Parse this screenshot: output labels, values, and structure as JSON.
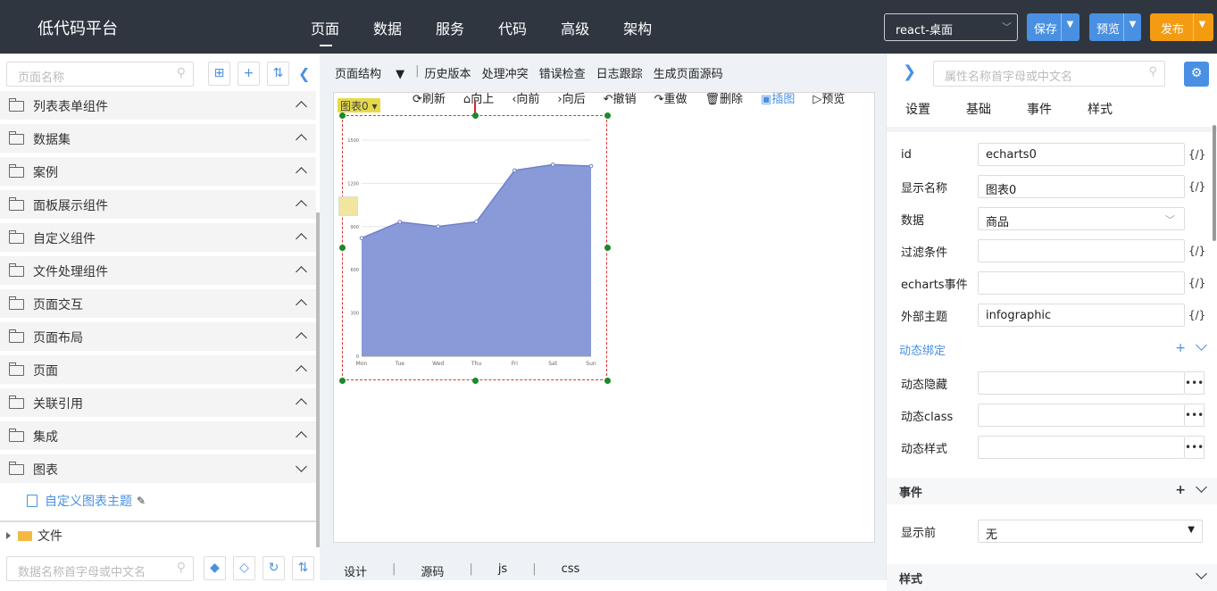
{
  "header": {
    "brand": "低代码平台",
    "nav": [
      "页面",
      "数据",
      "服务",
      "代码",
      "高级",
      "架构"
    ],
    "env_select": "react-桌面",
    "save": "保存",
    "preview": "预览",
    "publish": "发布"
  },
  "left": {
    "search_placeholder": "页面名称",
    "tree": [
      {
        "label": "列表表单组件",
        "expanded": false
      },
      {
        "label": "数据集",
        "expanded": false
      },
      {
        "label": "案例",
        "expanded": false
      },
      {
        "label": "面板展示组件",
        "expanded": false
      },
      {
        "label": "自定义组件",
        "expanded": false
      },
      {
        "label": "文件处理组件",
        "expanded": false
      },
      {
        "label": "页面交互",
        "expanded": false
      },
      {
        "label": "页面布局",
        "expanded": false
      },
      {
        "label": "页面",
        "expanded": false
      },
      {
        "label": "关联引用",
        "expanded": false
      },
      {
        "label": "集成",
        "expanded": false
      },
      {
        "label": "图表",
        "expanded": true
      }
    ],
    "subitem": "自定义图表主题",
    "file_label": "文件",
    "data_search_placeholder": "数据名称首字母或中文名"
  },
  "center": {
    "toolbar": [
      "页面结构",
      "历史版本",
      "处理冲突",
      "错误检查",
      "日志跟踪",
      "生成页面源码"
    ],
    "canvas_tools": [
      "刷新",
      "向上",
      "向前",
      "向后",
      "撤销",
      "重做",
      "删除",
      "插图",
      "预览"
    ],
    "chart_tag": "图表0",
    "bottom_tabs": [
      "设计",
      "源码",
      "js",
      "css"
    ]
  },
  "chart_data": {
    "type": "area",
    "categories": [
      "Mon",
      "Tue",
      "Wed",
      "Thu",
      "Fri",
      "Sat",
      "Sun"
    ],
    "values": [
      820,
      932,
      901,
      934,
      1290,
      1330,
      1320
    ],
    "ylim": [
      0,
      1500
    ],
    "yticks": [
      0,
      300,
      600,
      900,
      1200,
      1500
    ],
    "color": "#7b8fd4"
  },
  "right": {
    "search_placeholder": "属性名称首字母或中文名",
    "tabs": [
      "设置",
      "基础",
      "事件",
      "样式"
    ],
    "props": [
      {
        "label": "id",
        "value": "echarts0",
        "code": "{/}"
      },
      {
        "label": "显示名称",
        "value": "图表0",
        "code": "{/}"
      },
      {
        "label": "数据",
        "value": "商品",
        "code": ""
      },
      {
        "label": "过滤条件",
        "value": "",
        "code": "{/}"
      },
      {
        "label": "echarts事件",
        "value": "",
        "code": "{/}"
      },
      {
        "label": "外部主题",
        "value": "infographic",
        "code": "{/}"
      }
    ],
    "dyn_title": "动态绑定",
    "dyn_props": [
      "动态隐藏",
      "动态class",
      "动态样式"
    ],
    "events_title": "事件",
    "before_show_label": "显示前",
    "before_show_value": "无",
    "style_title": "样式"
  }
}
